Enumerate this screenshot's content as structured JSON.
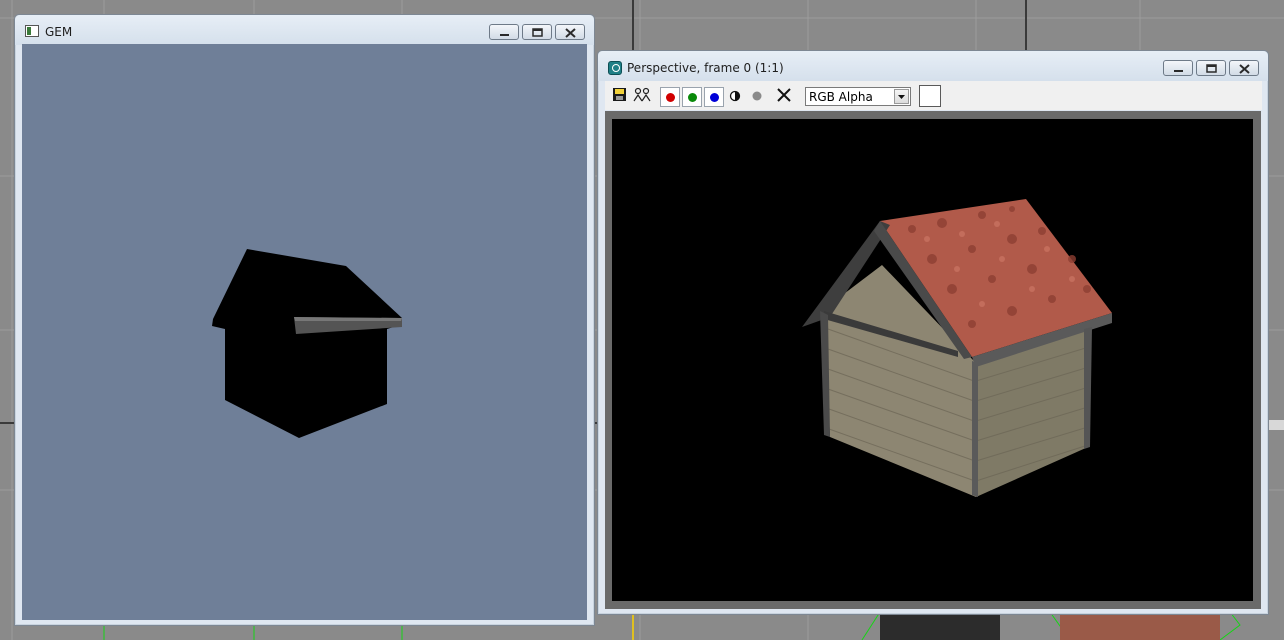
{
  "gem_window": {
    "title": "GEM",
    "controls": [
      "minimize-icon",
      "maximize-icon",
      "close-icon"
    ],
    "viewport_bg": "#6f7f98"
  },
  "perspective_window": {
    "title": "Perspective, frame 0 (1:1)",
    "controls": [
      "minimize-icon",
      "maximize-icon",
      "close-icon"
    ],
    "toolbar": {
      "channel_select_value": "RGB Alpha",
      "tools": [
        "save-icon",
        "clone-icon",
        "red-channel-icon",
        "green-channel-icon",
        "blue-channel-icon",
        "monochrome-icon",
        "alpha-icon",
        "clear-icon"
      ],
      "swatch_color": "#ffffff"
    },
    "render_bg": "#000000"
  },
  "colors": {
    "red_channel": "#d10000",
    "green_channel": "#0a8a0a",
    "blue_channel": "#0000d8",
    "roof": "#b15a4a",
    "wall": "#8d8672"
  }
}
